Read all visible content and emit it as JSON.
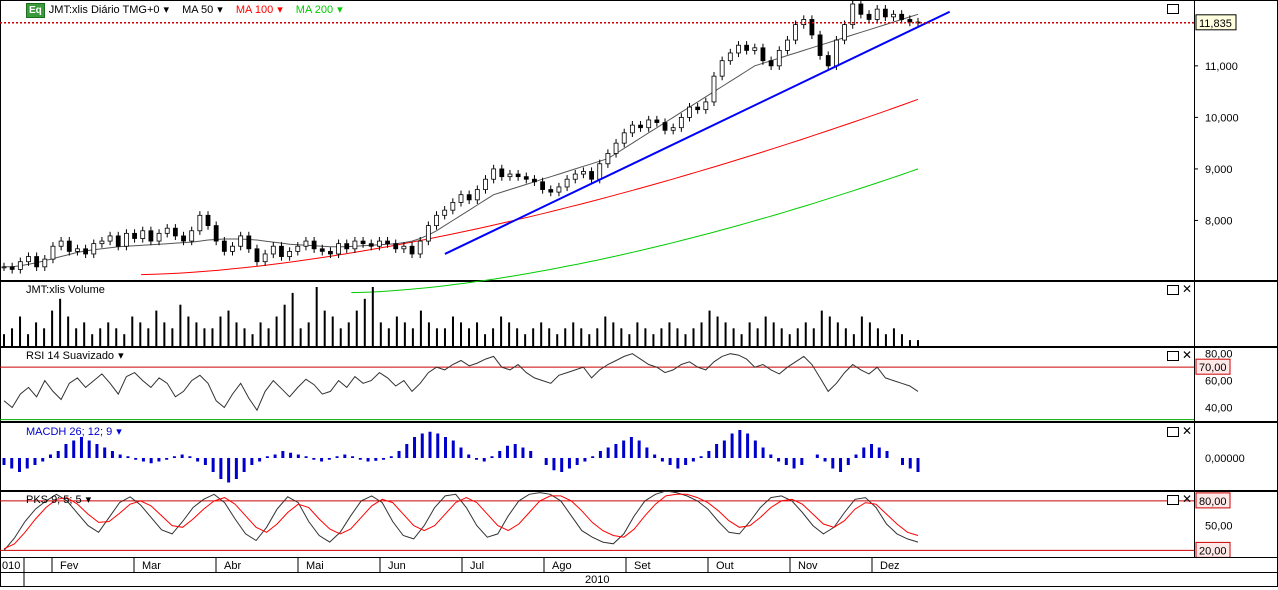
{
  "header": {
    "badge": "Eq",
    "symbol": "JMT:xlis Diário TMG+0",
    "ma50": "MA 50",
    "ma100": "MA 100",
    "ma200": "MA 200",
    "colors": {
      "ma50": "#000000",
      "ma100": "#ff0000",
      "ma200": "#00cc00",
      "trend": "#0000ff",
      "ref": "#cc0000"
    }
  },
  "panels": {
    "volume_label": "JMT:xlis Volume",
    "rsi_label": "RSI 14 Suavizado",
    "macd_label": "MACDH 26; 12; 9",
    "pks_label": "PKS 9; 5; 5"
  },
  "chart_data": [
    {
      "type": "candlestick",
      "title": "JMT:xlis Diário TMG+0",
      "y_ticks": [
        "8,000",
        "9,000",
        "10,000",
        "11,000"
      ],
      "last_price_label": "11,835",
      "last_price": 11.835,
      "ylim": [
        7.0,
        12.2
      ],
      "x_months": [
        "Fev",
        "Mar",
        "Abr",
        "Mai",
        "Jun",
        "Jul",
        "Ago",
        "Set",
        "Out",
        "Nov",
        "Dez"
      ],
      "x_year": "2010",
      "x_partial_left": "010",
      "close_series": [
        7.1,
        7.05,
        7.2,
        7.3,
        7.1,
        7.25,
        7.5,
        7.6,
        7.4,
        7.45,
        7.35,
        7.55,
        7.6,
        7.7,
        7.5,
        7.75,
        7.65,
        7.8,
        7.6,
        7.75,
        7.85,
        7.7,
        7.6,
        7.8,
        8.1,
        7.9,
        7.6,
        7.4,
        7.5,
        7.7,
        7.45,
        7.2,
        7.35,
        7.5,
        7.3,
        7.4,
        7.5,
        7.6,
        7.45,
        7.4,
        7.35,
        7.55,
        7.45,
        7.6,
        7.55,
        7.5,
        7.6,
        7.55,
        7.45,
        7.5,
        7.35,
        7.6,
        7.9,
        8.1,
        8.2,
        8.35,
        8.5,
        8.4,
        8.6,
        8.8,
        9.0,
        8.85,
        8.9,
        8.85,
        8.8,
        8.75,
        8.6,
        8.55,
        8.65,
        8.8,
        8.9,
        8.95,
        8.8,
        9.1,
        9.3,
        9.5,
        9.7,
        9.85,
        9.8,
        9.95,
        9.9,
        9.75,
        9.8,
        10.0,
        10.2,
        10.15,
        10.3,
        10.8,
        11.1,
        11.25,
        11.4,
        11.3,
        11.35,
        11.1,
        11.0,
        11.3,
        11.5,
        11.8,
        11.9,
        11.6,
        11.2,
        11.0,
        11.5,
        11.8,
        12.2,
        12.0,
        11.9,
        12.1,
        11.95,
        12.0,
        11.9,
        11.85,
        11.835
      ],
      "ma50": [
        7.1,
        7.1,
        7.12,
        7.15,
        7.18,
        7.22,
        7.26,
        7.3,
        7.34,
        7.38,
        7.41,
        7.43,
        7.45,
        7.47,
        7.49,
        7.5,
        7.51,
        7.52,
        7.53,
        7.54,
        7.55,
        7.56,
        7.57,
        7.58,
        7.6,
        7.62,
        7.63,
        7.64,
        7.64,
        7.64,
        7.63,
        7.62,
        7.6,
        7.58,
        7.56,
        7.54,
        7.53,
        7.52,
        7.51,
        7.5,
        7.49,
        7.49,
        7.49,
        7.5,
        7.51,
        7.52,
        7.53,
        7.54,
        7.55,
        7.57,
        7.6,
        7.65,
        7.72,
        7.8,
        7.9,
        8.0,
        8.1,
        8.2,
        8.3,
        8.4,
        8.5,
        8.55,
        8.6,
        8.65,
        8.7,
        8.75,
        8.8,
        8.85,
        8.9,
        8.95,
        9.0,
        9.05,
        9.1,
        9.15,
        9.2,
        9.3,
        9.4,
        9.5,
        9.6,
        9.7,
        9.8,
        9.9,
        10.0,
        10.1,
        10.2,
        10.3,
        10.4,
        10.5,
        10.6,
        10.7,
        10.8,
        10.9,
        11.0,
        11.05,
        11.1,
        11.15,
        11.2,
        11.25,
        11.3,
        11.35,
        11.4,
        11.45,
        11.5,
        11.55,
        11.6,
        11.65,
        11.7,
        11.75,
        11.8,
        11.85,
        11.9,
        11.95,
        12.0
      ],
      "ma100_endpoints": [
        6.95,
        10.35
      ],
      "ma200_endpoints": [
        6.6,
        9.0
      ],
      "trendline": [
        [
          0.345,
          7.35
        ],
        [
          0.74,
          12.05
        ]
      ]
    },
    {
      "type": "bar",
      "title": "JMT:xlis Volume",
      "values": [
        2,
        3,
        5,
        2,
        4,
        3,
        6,
        8,
        5,
        3,
        4,
        2,
        3,
        4,
        3,
        2,
        5,
        4,
        3,
        6,
        4,
        3,
        7,
        5,
        4,
        3,
        3,
        5,
        6,
        4,
        3,
        2,
        4,
        3,
        5,
        7,
        9,
        3,
        4,
        10,
        6,
        5,
        3,
        4,
        6,
        8,
        10,
        4,
        3,
        5,
        4,
        3,
        6,
        4,
        3,
        3,
        5,
        4,
        3,
        4,
        2,
        3,
        5,
        4,
        3,
        2,
        3,
        4,
        3,
        2,
        3,
        4,
        3,
        2,
        3,
        5,
        4,
        3,
        2,
        4,
        3,
        2,
        3,
        4,
        3,
        2,
        3,
        4,
        6,
        5,
        4,
        3,
        2,
        4,
        3,
        5,
        4,
        3,
        2,
        3,
        4,
        3,
        6,
        5,
        4,
        3,
        2,
        5,
        4,
        3,
        2,
        3,
        2,
        1,
        1
      ]
    },
    {
      "type": "line",
      "title": "RSI 14 Suavizado",
      "y_ticks": [
        "40,00",
        "60,00",
        "80,00"
      ],
      "upper_label": "70,00",
      "ylim": [
        30,
        85
      ],
      "values": [
        45,
        40,
        50,
        55,
        48,
        60,
        52,
        46,
        58,
        62,
        55,
        60,
        65,
        58,
        50,
        63,
        66,
        60,
        55,
        62,
        58,
        48,
        52,
        60,
        64,
        58,
        45,
        40,
        50,
        58,
        47,
        38,
        52,
        60,
        54,
        48,
        55,
        61,
        57,
        50,
        52,
        60,
        55,
        63,
        58,
        60,
        66,
        62,
        56,
        60,
        52,
        58,
        66,
        70,
        68,
        72,
        75,
        71,
        73,
        76,
        78,
        70,
        68,
        72,
        66,
        62,
        60,
        58,
        64,
        66,
        68,
        70,
        62,
        68,
        72,
        75,
        78,
        80,
        76,
        72,
        70,
        66,
        68,
        72,
        74,
        70,
        68,
        74,
        78,
        80,
        79,
        76,
        70,
        72,
        68,
        65,
        70,
        74,
        78,
        72,
        62,
        52,
        58,
        66,
        72,
        68,
        65,
        70,
        62,
        60,
        58,
        56,
        52
      ]
    },
    {
      "type": "bar",
      "title": "MACDH 26; 12; 9",
      "y_ticks": [
        "0,00000"
      ],
      "values": [
        -2,
        -3,
        -4,
        -3,
        -2,
        -1,
        1,
        2,
        4,
        5,
        6,
        5,
        4,
        3,
        2,
        1,
        0.5,
        -0.5,
        -1,
        -1.5,
        -1,
        -0.5,
        0.5,
        1,
        0.5,
        -1,
        -2,
        -4,
        -6,
        -7,
        -6,
        -4,
        -2,
        -1,
        0.5,
        1,
        2,
        1.5,
        1,
        0.5,
        -0.5,
        -1,
        -0.5,
        0.5,
        1,
        0.5,
        -0.5,
        -1,
        -0.8,
        -0.5,
        0.5,
        2,
        4,
        6,
        7,
        7.5,
        7,
        6,
        5,
        3,
        1,
        -0.5,
        -1,
        0.5,
        2,
        3.5,
        4,
        3,
        2,
        0,
        -2,
        -3.5,
        -4,
        -3,
        -2,
        -1,
        0.5,
        2,
        3,
        4,
        5,
        6,
        5,
        3,
        1,
        -1,
        -2,
        -3,
        -2,
        -1,
        0.5,
        2,
        4,
        5,
        7,
        8,
        7,
        5,
        3,
        1,
        -1,
        -2,
        -3,
        -2,
        0,
        1,
        -1,
        -3,
        -4,
        -2,
        1,
        3,
        4,
        3,
        2,
        0,
        -2,
        -3,
        -4
      ]
    },
    {
      "type": "line",
      "title": "PKS 9; 5; 5",
      "y_ticks": [
        "50,00"
      ],
      "upper_label": "80,00",
      "lower_label": "20,00",
      "ylim": [
        12,
        92
      ],
      "k": [
        20,
        35,
        55,
        70,
        80,
        88,
        80,
        65,
        50,
        42,
        60,
        78,
        85,
        75,
        60,
        45,
        40,
        55,
        72,
        82,
        88,
        78,
        58,
        40,
        32,
        48,
        70,
        85,
        78,
        55,
        38,
        30,
        42,
        62,
        80,
        86,
        78,
        55,
        38,
        34,
        50,
        72,
        86,
        88,
        72,
        50,
        36,
        40,
        62,
        80,
        88,
        90,
        88,
        80,
        62,
        44,
        36,
        30,
        28,
        40,
        62,
        80,
        88,
        92,
        90,
        86,
        80,
        70,
        55,
        42,
        40,
        55,
        72,
        84,
        86,
        80,
        66,
        50,
        40,
        48,
        66,
        82,
        84,
        72,
        52,
        40,
        34,
        30
      ],
      "d": [
        22,
        28,
        42,
        58,
        72,
        82,
        84,
        76,
        64,
        54,
        55,
        65,
        76,
        80,
        74,
        62,
        50,
        48,
        58,
        70,
        80,
        84,
        76,
        62,
        48,
        42,
        52,
        66,
        76,
        72,
        58,
        46,
        40,
        46,
        60,
        74,
        82,
        78,
        64,
        50,
        44,
        50,
        64,
        78,
        84,
        78,
        64,
        50,
        44,
        52,
        66,
        80,
        86,
        86,
        80,
        68,
        54,
        44,
        38,
        36,
        46,
        62,
        76,
        86,
        88,
        88,
        84,
        78,
        68,
        56,
        48,
        50,
        60,
        72,
        80,
        82,
        76,
        64,
        52,
        48,
        56,
        70,
        78,
        76,
        64,
        52,
        42,
        38
      ]
    }
  ]
}
